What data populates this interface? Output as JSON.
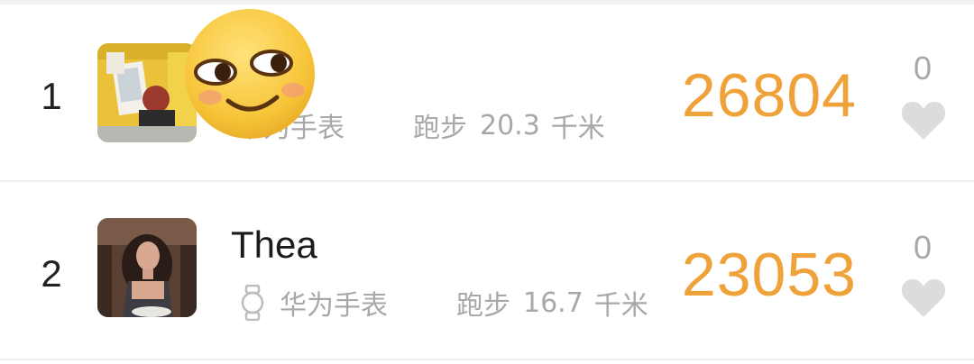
{
  "leaderboard": {
    "rows": [
      {
        "rank": "1",
        "name": "",
        "device": "华为手表",
        "activity": "跑步",
        "distance": "20.3",
        "unit": "千米",
        "score": "26804",
        "likes": "0",
        "avatar": "avatar-1"
      },
      {
        "rank": "2",
        "name": "Thea",
        "device": "华为手表",
        "activity": "跑步",
        "distance": "16.7",
        "unit": "千米",
        "score": "23053",
        "likes": "0",
        "avatar": "avatar-2"
      }
    ]
  },
  "colors": {
    "score": "#f0a23a",
    "muted": "#a8a8a8",
    "divider": "#ececec",
    "heart": "#dcdcdc"
  },
  "icons": [
    "watch-icon",
    "heart-icon",
    "smiling-face-sticker"
  ]
}
